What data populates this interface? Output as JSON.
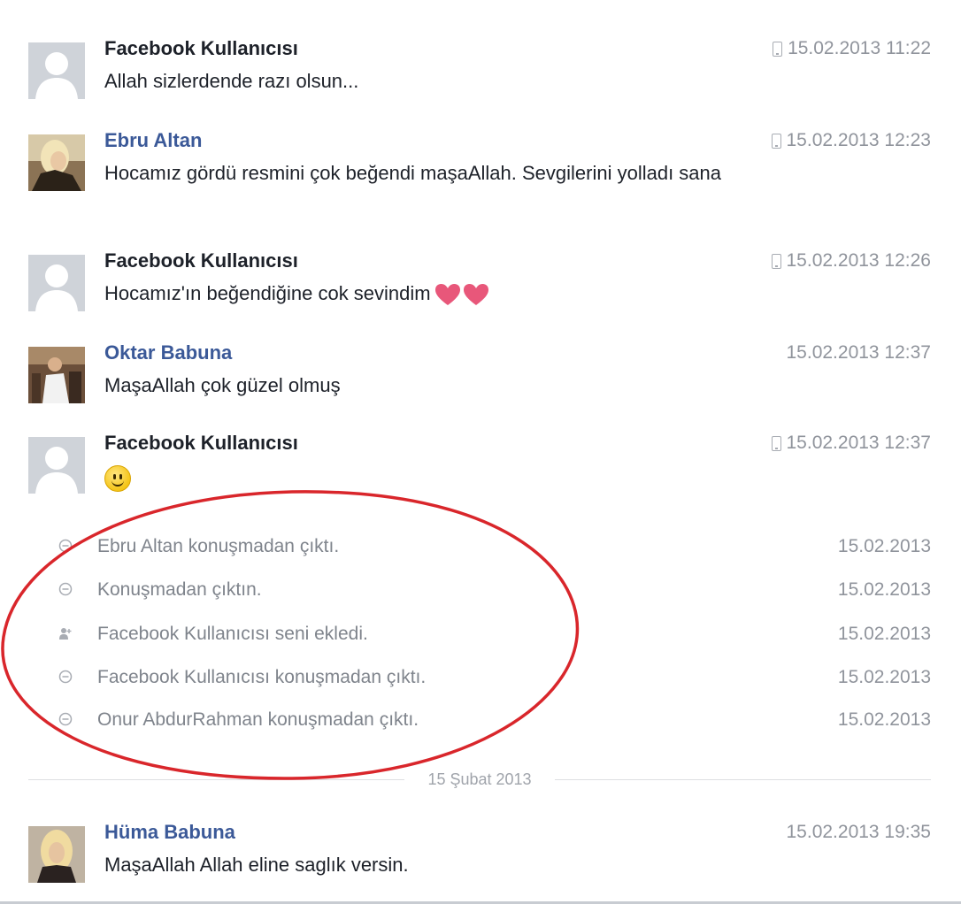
{
  "messages": [
    {
      "name": "Facebook Kullanıcısı",
      "name_style": "user",
      "text": "Allah sizlerdende razı olsun...",
      "time": "15.02.2013 11:22",
      "mobile": true,
      "avatar": "default-avatar"
    },
    {
      "name": "Ebru Altan",
      "name_style": "friend",
      "text": "Hocamız gördü resmini çok beğendi maşaAllah. Sevgilerini yolladı sana",
      "time": "15.02.2013 12:23",
      "mobile": true,
      "avatar": "photo-avatar"
    },
    {
      "name": "Facebook Kullanıcısı",
      "name_style": "user",
      "text": "Hocamız'ın beğendiğine cok sevindim",
      "emoji": "heart-heart",
      "time": "15.02.2013 12:26",
      "mobile": true,
      "avatar": "default-avatar"
    },
    {
      "name": "Oktar Babuna",
      "name_style": "friend",
      "text": "MaşaAllah çok güzel olmuş",
      "time": "15.02.2013 12:37",
      "mobile": false,
      "avatar": "photo-avatar"
    },
    {
      "name": "Facebook Kullanıcısı",
      "name_style": "user",
      "text": "",
      "emoji": "smiley",
      "time": "15.02.2013 12:37",
      "mobile": true,
      "avatar": "default-avatar"
    }
  ],
  "events": [
    {
      "icon": "leave-icon",
      "text": "Ebru Altan konuşmadan çıktı.",
      "date": "15.02.2013"
    },
    {
      "icon": "leave-icon",
      "text": "Konuşmadan çıktın.",
      "date": "15.02.2013"
    },
    {
      "icon": "add-person-icon",
      "text": "Facebook Kullanıcısı seni ekledi.",
      "date": "15.02.2013"
    },
    {
      "icon": "leave-icon",
      "text": "Facebook Kullanıcısı konuşmadan çıktı.",
      "date": "15.02.2013"
    },
    {
      "icon": "leave-icon",
      "text": "Onur AbdurRahman konuşmadan çıktı.",
      "date": "15.02.2013"
    }
  ],
  "divider": {
    "label": "15 Şubat 2013"
  },
  "last_message": {
    "name": "Hüma Babuna",
    "name_style": "friend",
    "text": "MaşaAllah Allah eline saglık versin.",
    "time": "15.02.2013 19:35",
    "mobile": false,
    "avatar": "photo-avatar"
  },
  "colors": {
    "friend_name": "#3b5998",
    "meta_text": "#90949c",
    "annotation_ellipse": "#d9262b",
    "heart": "#e8577a"
  }
}
